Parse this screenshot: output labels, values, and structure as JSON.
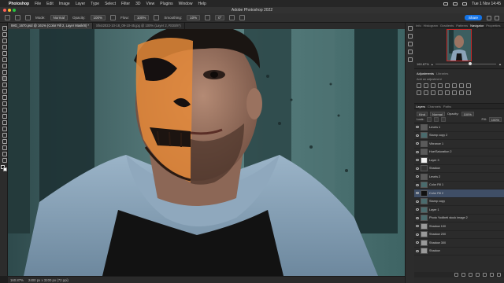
{
  "menubar": {
    "app_name": "Photoshop",
    "items": [
      "File",
      "Edit",
      "Image",
      "Layer",
      "Type",
      "Select",
      "Filter",
      "3D",
      "View",
      "Plugins",
      "Window",
      "Help"
    ],
    "clock": "Tue 1 Nov 14:45"
  },
  "titlebar": {
    "title": "Adobe Photoshop 2022"
  },
  "options": {
    "mode_label": "Mode:",
    "mode_value": "Normal",
    "opacity_label": "Opacity:",
    "opacity_value": "100%",
    "flow_label": "Flow:",
    "flow_value": "100%",
    "smoothing_label": "Smoothing:",
    "smoothing_value": "10%",
    "angle_value": "0°",
    "share_label": "Share"
  },
  "doc_tabs": [
    {
      "label": "IMG_1670.psd @ 161% (Color Fill 2, Layer Mask/8) *",
      "active": true
    },
    {
      "label": "Shot2022-10-18_09-10-45.jpg @ 100% (Layer 2, RGB/8*)",
      "active": false
    }
  ],
  "status": {
    "zoom": "160.87%",
    "doc_size": "2400 px x 3200 px (72 ppi)"
  },
  "panels": {
    "top_tabs": [
      "Info",
      "Histogram",
      "Gradients",
      "Patterns",
      "Navigator",
      "Properties"
    ],
    "active_top_tab": "Navigator",
    "nav_zoom": "160.87%",
    "adj_tabs": [
      "Adjustments",
      "Libraries"
    ],
    "adj_hint": "Add an adjustment",
    "layers_tabs": [
      "Layers",
      "Channels",
      "Paths"
    ],
    "kind_label": "Kind",
    "blend_mode": "Normal",
    "opacity_label": "Opacity:",
    "opacity_value": "100%",
    "lock_label": "Lock:",
    "fill_label": "Fill:",
    "fill_value": "100%"
  },
  "layers": [
    {
      "name": "Levels 1",
      "thumb": "adj",
      "selected": false
    },
    {
      "name": "Stamp copy 2",
      "thumb": "photo",
      "selected": false
    },
    {
      "name": "Vibrance 1",
      "thumb": "adj",
      "selected": false
    },
    {
      "name": "Hue/Saturation 2",
      "thumb": "adj",
      "selected": false
    },
    {
      "name": "Layer 3",
      "thumb": "white",
      "selected": false
    },
    {
      "name": "Shadow",
      "thumb": "dark",
      "selected": false
    },
    {
      "name": "Levels 2",
      "thumb": "adj",
      "selected": false
    },
    {
      "name": "Color Fill 1",
      "thumb": "photo",
      "selected": false
    },
    {
      "name": "Color Fill 2",
      "thumb": "mask",
      "selected": true
    },
    {
      "name": "Stamp copy",
      "thumb": "photo",
      "selected": false
    },
    {
      "name": "Layer 1",
      "thumb": "photo",
      "selected": false
    },
    {
      "name": "Photo Yodibeti stock image 2",
      "thumb": "photo",
      "selected": false
    },
    {
      "name": "Shadow 100",
      "thumb": "grey",
      "selected": false
    },
    {
      "name": "Shadow 200",
      "thumb": "grey",
      "selected": false
    },
    {
      "name": "Shadow 300",
      "thumb": "grey",
      "selected": false
    },
    {
      "name": "Shadow",
      "thumb": "grey",
      "selected": false
    }
  ],
  "colors": {
    "accent": "#1473e6",
    "selected_layer": "#3f4e66",
    "close": "#ff5f57",
    "minimize": "#febc2e",
    "zoom": "#28c840"
  },
  "icons": {
    "toolbar": [
      "move-icon",
      "marquee-icon",
      "lasso-icon",
      "magic-wand-icon",
      "crop-icon",
      "frame-icon",
      "eyedropper-icon",
      "healing-icon",
      "brush-icon",
      "stamp-icon",
      "history-brush-icon",
      "eraser-icon",
      "gradient-icon",
      "blur-icon",
      "dodge-icon",
      "pen-icon",
      "type-icon",
      "path-select-icon",
      "rectangle-icon",
      "hand-icon",
      "zoom-icon",
      "more-icon"
    ]
  }
}
